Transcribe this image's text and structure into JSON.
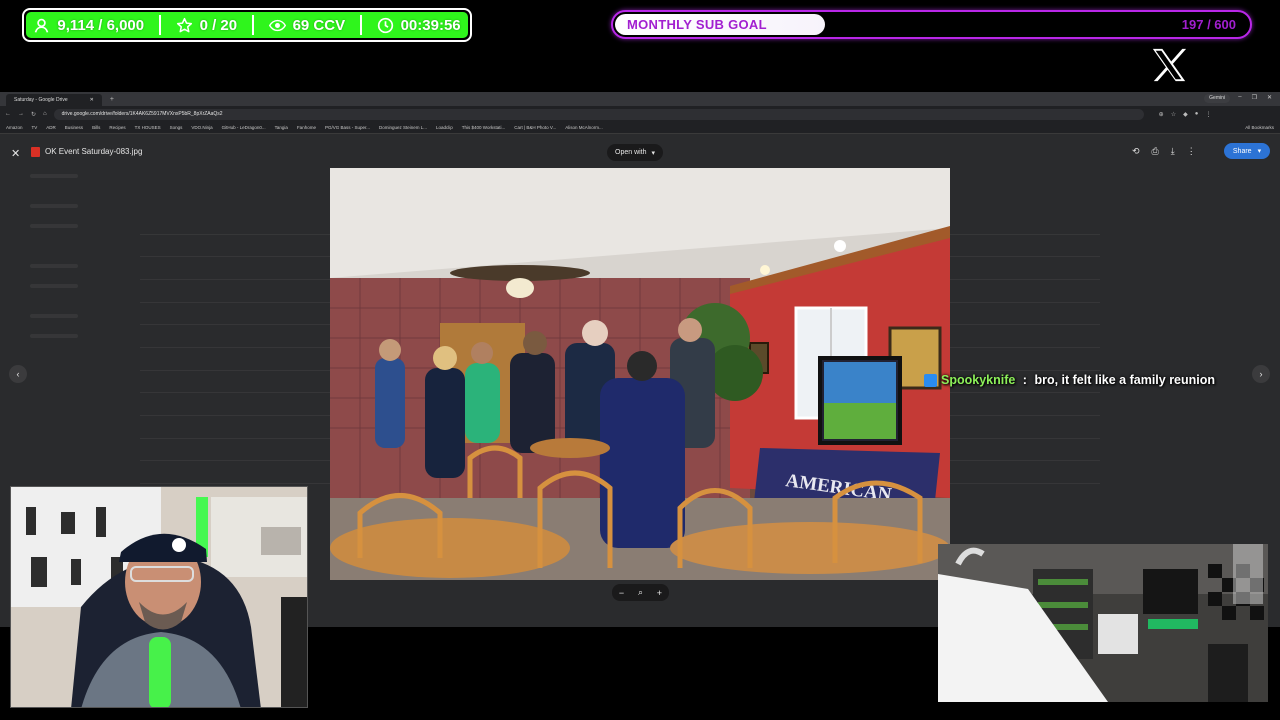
{
  "overlay": {
    "stats": {
      "followers": "9,114 / 6,000",
      "subs": "0 / 20",
      "viewers": "69 CCV",
      "uptime": "00:39:56",
      "accent_color": "#2ff51c",
      "icons": [
        "person-icon",
        "star-icon",
        "eye-icon",
        "clock-icon"
      ]
    },
    "sub_goal": {
      "title": "MONTHLY SUB GOAL",
      "count": "197 / 600",
      "progress": 0.33,
      "accent_color": "#b927e8"
    },
    "social_icon": "x-logo-icon"
  },
  "browser": {
    "tab_title": "Saturday - Google Drive",
    "gemini_label": "Gemini",
    "url": "drive.google.com/drive/folders/1K4AK6Z5917MVXnxP5bR_8pXrZAaQs2",
    "bookmarks": [
      "Amazon",
      "TV",
      "ADR",
      "Business",
      "Bills",
      "Recipes",
      "TX HOUSES",
      "Songs",
      "VDO.Ninja",
      "GitHub - LeDragon0...",
      "Tangia",
      "Fanhome",
      "PG/VG Bass - Super...",
      "Dominguez Steinem L...",
      "Loadclip",
      "This $400 Workstati...",
      "Cart | B&H Photo V...",
      "Alison McAlnorm..."
    ],
    "all_bookmarks": "All Bookmarks"
  },
  "viewer": {
    "file_name": "OK Event Saturday-083.jpg",
    "open_with": "Open with",
    "share_label": "Share"
  },
  "chat": {
    "username": "Spookyknife",
    "separator": " : ",
    "message": "bro, it felt like a family reunion",
    "username_color": "#8df05a"
  }
}
